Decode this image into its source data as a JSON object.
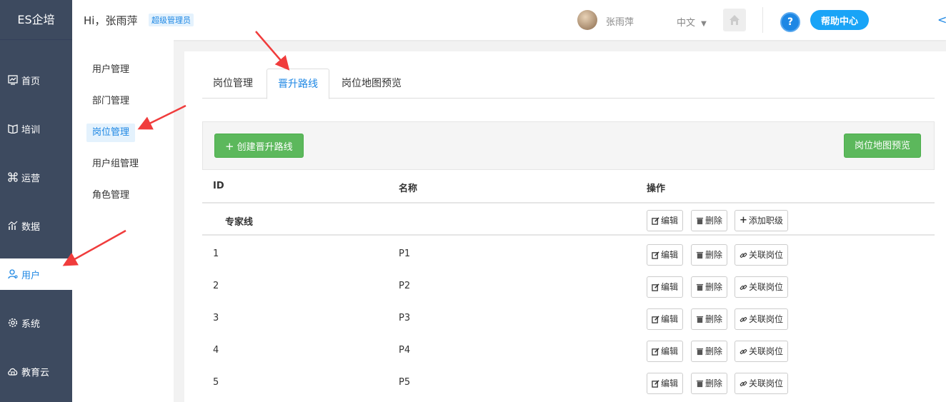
{
  "brand": "ES企培",
  "nav": [
    {
      "label": "首页",
      "icon": "chart-icon"
    },
    {
      "label": "培训",
      "icon": "book-icon"
    },
    {
      "label": "运营",
      "icon": "command-icon"
    },
    {
      "label": "数据",
      "icon": "stats-icon"
    },
    {
      "label": "用户",
      "icon": "user-icon"
    },
    {
      "label": "系统",
      "icon": "gear-icon"
    },
    {
      "label": "教育云",
      "icon": "cloud-icon"
    }
  ],
  "header": {
    "greeting": "Hi，张雨萍",
    "role": "超级管理员",
    "username": "张雨萍",
    "language": "中文",
    "help": "帮助中心",
    "help_mark": "?"
  },
  "submenu": [
    "用户管理",
    "部门管理",
    "岗位管理",
    "用户组管理",
    "角色管理"
  ],
  "tabs": [
    "岗位管理",
    "晋升路线",
    "岗位地图预览"
  ],
  "toolbar": {
    "create": "创建晋升路线",
    "preview": "岗位地图预览"
  },
  "table": {
    "headers": [
      "ID",
      "名称",
      "操作"
    ],
    "group": {
      "name": "专家线",
      "actions": [
        "编辑",
        "删除",
        "添加职级"
      ]
    },
    "rows": [
      {
        "id": "1",
        "name": "P1"
      },
      {
        "id": "2",
        "name": "P2"
      },
      {
        "id": "3",
        "name": "P3"
      },
      {
        "id": "4",
        "name": "P4"
      },
      {
        "id": "5",
        "name": "P5"
      }
    ],
    "row_actions": [
      "编辑",
      "删除",
      "关联岗位"
    ]
  },
  "colors": {
    "nav_bg": "#3d4a5f",
    "accent": "#1d87e4",
    "green": "#5cb85c",
    "annotation": "#f03c3c"
  }
}
